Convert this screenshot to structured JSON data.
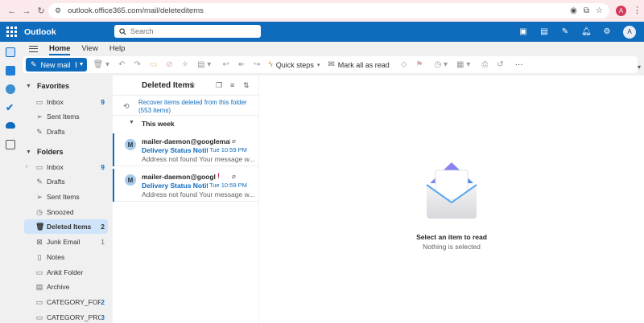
{
  "browser": {
    "url": "outlook.office365.com/mail/deleteditems",
    "avatar_letter": "A"
  },
  "header": {
    "app_title": "Outlook",
    "search_placeholder": "Search",
    "avatar_letter": "A",
    "icons": [
      "video-icon",
      "notes-icon",
      "edit-icon",
      "bell-icon",
      "gear-icon"
    ]
  },
  "ribbon": {
    "tabs": [
      {
        "label": "Home",
        "active": true
      },
      {
        "label": "View",
        "active": false
      },
      {
        "label": "Help",
        "active": false
      }
    ],
    "new_mail_label": "New mail",
    "quick_steps_label": "Quick steps",
    "mark_all_read_label": "Mark all as read"
  },
  "folders": {
    "favorites_label": "Favorites",
    "favorites": [
      {
        "name": "Inbox",
        "count": "9",
        "icon": "inbox-icon"
      },
      {
        "name": "Sent Items",
        "count": "",
        "icon": "send-icon"
      },
      {
        "name": "Drafts",
        "count": "",
        "icon": "pencil-icon"
      }
    ],
    "folders_label": "Folders",
    "items": [
      {
        "name": "Inbox",
        "count": "9",
        "icon": "inbox-icon",
        "expandable": true
      },
      {
        "name": "Drafts",
        "count": "",
        "icon": "pencil-icon"
      },
      {
        "name": "Sent Items",
        "count": "",
        "icon": "send-icon"
      },
      {
        "name": "Snoozed",
        "count": "",
        "icon": "clock-icon"
      },
      {
        "name": "Deleted Items",
        "count": "2",
        "icon": "trash-icon",
        "selected": true
      },
      {
        "name": "Junk Email",
        "count": "1",
        "icon": "junk-icon",
        "gray": true
      },
      {
        "name": "Notes",
        "count": "",
        "icon": "note-icon"
      },
      {
        "name": "Ankit Folder",
        "count": "",
        "icon": "folder-icon"
      },
      {
        "name": "Archive",
        "count": "",
        "icon": "archive-icon"
      },
      {
        "name": "CATEGORY_FOR...",
        "count": "2",
        "icon": "folder-icon"
      },
      {
        "name": "CATEGORY_PRO...",
        "count": "3",
        "icon": "folder-icon"
      }
    ]
  },
  "list": {
    "title": "Deleted Items",
    "recover_text": "Recover items deleted from this folder (553 items)",
    "group_label": "This week",
    "messages": [
      {
        "avatar": "M",
        "from": "mailer-daemon@googlemail....",
        "subject": "Delivery Status Notifi...",
        "time": "Tue 10:59 PM",
        "preview": "Address not found Your message w...",
        "important": false
      },
      {
        "avatar": "M",
        "from": "mailer-daemon@google...",
        "subject": "Delivery Status Notifi...",
        "time": "Tue 10:59 PM",
        "preview": "Address not found Your message w...",
        "important": true
      }
    ]
  },
  "reading": {
    "title": "Select an item to read",
    "subtitle": "Nothing is selected"
  }
}
